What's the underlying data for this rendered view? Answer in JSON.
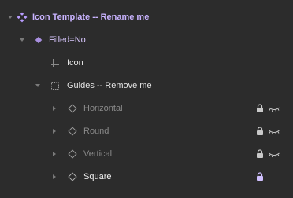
{
  "layers": [
    {
      "label": "Icon Template -- Rename me",
      "icon": "component-set-icon"
    },
    {
      "label": "Filled=No",
      "icon": "variant-icon"
    },
    {
      "label": "Icon",
      "icon": "frame-icon"
    },
    {
      "label": "Guides -- Remove me",
      "icon": "group-icon"
    },
    {
      "label": "Horizontal",
      "icon": "instance-icon",
      "locked": true,
      "hidden": true
    },
    {
      "label": "Round",
      "icon": "instance-icon",
      "locked": true,
      "hidden": true
    },
    {
      "label": "Vertical",
      "icon": "instance-icon",
      "locked": true,
      "hidden": true
    },
    {
      "label": "Square",
      "icon": "instance-icon",
      "locked": true,
      "hidden": false
    }
  ],
  "colors": {
    "background": "#2c2c2c",
    "component": "#c9b3ff",
    "dim": "#8a8a8a"
  }
}
